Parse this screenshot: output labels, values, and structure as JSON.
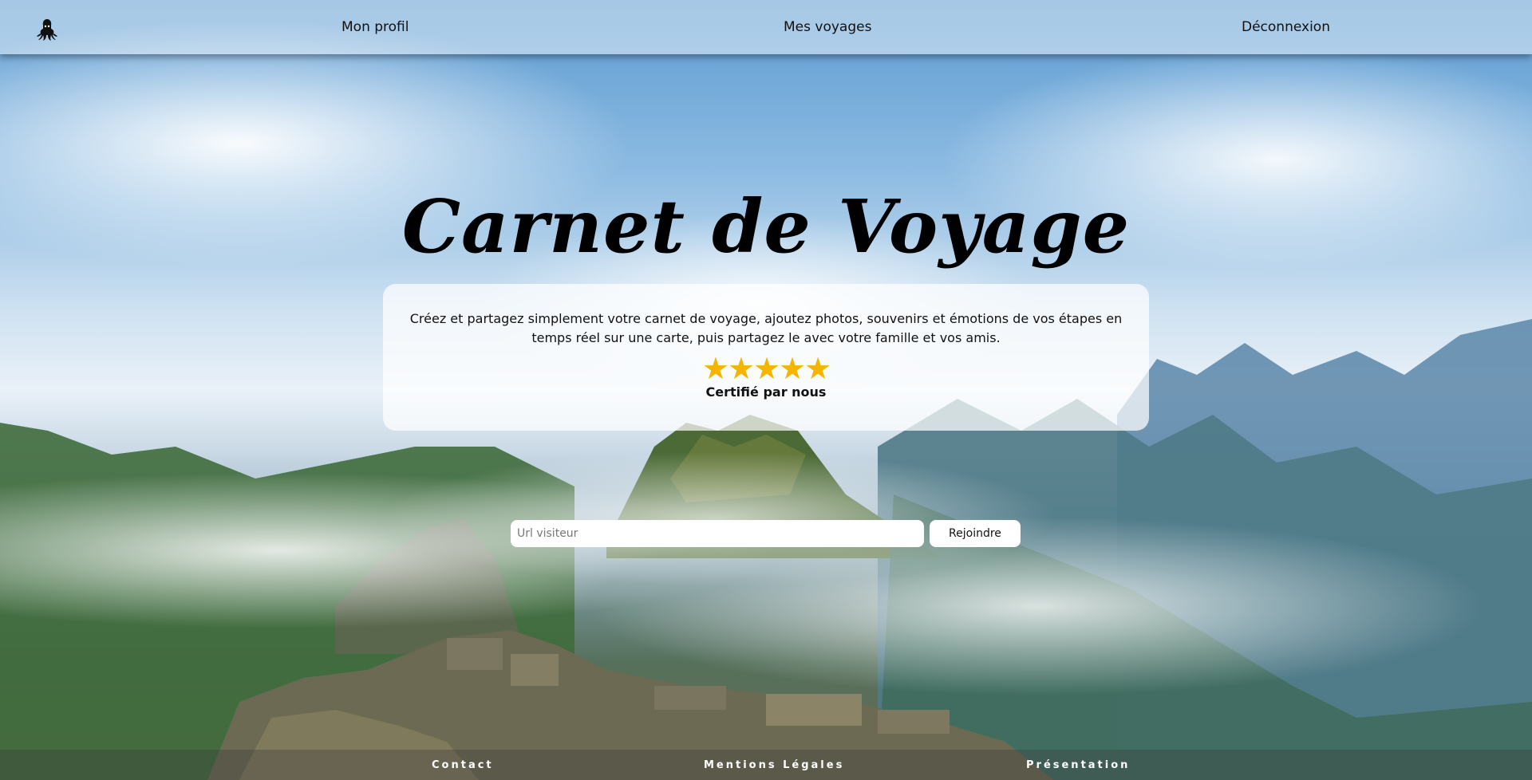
{
  "header": {
    "logo_icon": "squid-icon",
    "nav": {
      "profil": "Mon profil",
      "voyages": "Mes voyages",
      "deconnexion": "Déconnexion"
    }
  },
  "hero": {
    "title": "Carnet de Voyage"
  },
  "intro_card": {
    "description": "Créez et partagez simplement votre carnet de voyage, ajoutez photos, souvenirs et émotions de vos étapes en temps réel sur une carte, puis partagez le avec votre famille et vos amis.",
    "rating_stars": 5,
    "rating_glyphs": "★★★★★",
    "certified_label": "Certifié par nous",
    "star_color": "#f5b400"
  },
  "join_form": {
    "url_placeholder": "Url visiteur",
    "url_value": "",
    "join_label": "Rejoindre"
  },
  "footer": {
    "contact": "Contact",
    "mentions": "Mentions Légales",
    "presentation": "Présentation"
  }
}
